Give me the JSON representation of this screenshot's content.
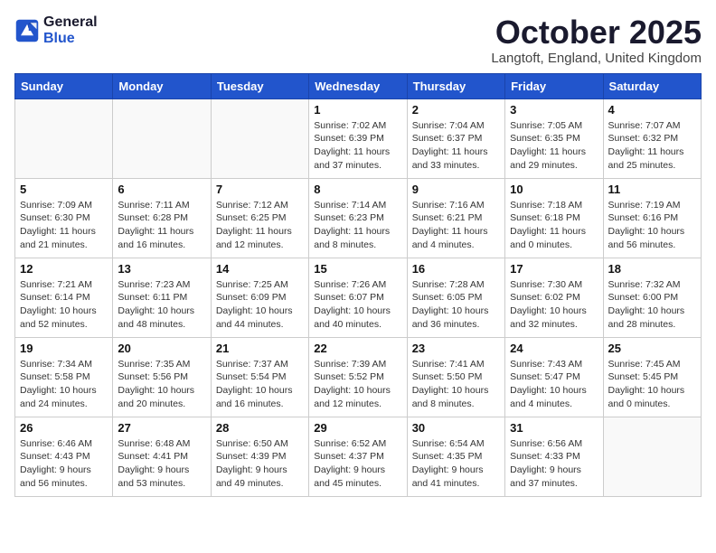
{
  "logo": {
    "line1": "General",
    "line2": "Blue"
  },
  "title": "October 2025",
  "location": "Langtoft, England, United Kingdom",
  "days_of_week": [
    "Sunday",
    "Monday",
    "Tuesday",
    "Wednesday",
    "Thursday",
    "Friday",
    "Saturday"
  ],
  "weeks": [
    [
      {
        "day": "",
        "info": ""
      },
      {
        "day": "",
        "info": ""
      },
      {
        "day": "",
        "info": ""
      },
      {
        "day": "1",
        "info": "Sunrise: 7:02 AM\nSunset: 6:39 PM\nDaylight: 11 hours\nand 37 minutes."
      },
      {
        "day": "2",
        "info": "Sunrise: 7:04 AM\nSunset: 6:37 PM\nDaylight: 11 hours\nand 33 minutes."
      },
      {
        "day": "3",
        "info": "Sunrise: 7:05 AM\nSunset: 6:35 PM\nDaylight: 11 hours\nand 29 minutes."
      },
      {
        "day": "4",
        "info": "Sunrise: 7:07 AM\nSunset: 6:32 PM\nDaylight: 11 hours\nand 25 minutes."
      }
    ],
    [
      {
        "day": "5",
        "info": "Sunrise: 7:09 AM\nSunset: 6:30 PM\nDaylight: 11 hours\nand 21 minutes."
      },
      {
        "day": "6",
        "info": "Sunrise: 7:11 AM\nSunset: 6:28 PM\nDaylight: 11 hours\nand 16 minutes."
      },
      {
        "day": "7",
        "info": "Sunrise: 7:12 AM\nSunset: 6:25 PM\nDaylight: 11 hours\nand 12 minutes."
      },
      {
        "day": "8",
        "info": "Sunrise: 7:14 AM\nSunset: 6:23 PM\nDaylight: 11 hours\nand 8 minutes."
      },
      {
        "day": "9",
        "info": "Sunrise: 7:16 AM\nSunset: 6:21 PM\nDaylight: 11 hours\nand 4 minutes."
      },
      {
        "day": "10",
        "info": "Sunrise: 7:18 AM\nSunset: 6:18 PM\nDaylight: 11 hours\nand 0 minutes."
      },
      {
        "day": "11",
        "info": "Sunrise: 7:19 AM\nSunset: 6:16 PM\nDaylight: 10 hours\nand 56 minutes."
      }
    ],
    [
      {
        "day": "12",
        "info": "Sunrise: 7:21 AM\nSunset: 6:14 PM\nDaylight: 10 hours\nand 52 minutes."
      },
      {
        "day": "13",
        "info": "Sunrise: 7:23 AM\nSunset: 6:11 PM\nDaylight: 10 hours\nand 48 minutes."
      },
      {
        "day": "14",
        "info": "Sunrise: 7:25 AM\nSunset: 6:09 PM\nDaylight: 10 hours\nand 44 minutes."
      },
      {
        "day": "15",
        "info": "Sunrise: 7:26 AM\nSunset: 6:07 PM\nDaylight: 10 hours\nand 40 minutes."
      },
      {
        "day": "16",
        "info": "Sunrise: 7:28 AM\nSunset: 6:05 PM\nDaylight: 10 hours\nand 36 minutes."
      },
      {
        "day": "17",
        "info": "Sunrise: 7:30 AM\nSunset: 6:02 PM\nDaylight: 10 hours\nand 32 minutes."
      },
      {
        "day": "18",
        "info": "Sunrise: 7:32 AM\nSunset: 6:00 PM\nDaylight: 10 hours\nand 28 minutes."
      }
    ],
    [
      {
        "day": "19",
        "info": "Sunrise: 7:34 AM\nSunset: 5:58 PM\nDaylight: 10 hours\nand 24 minutes."
      },
      {
        "day": "20",
        "info": "Sunrise: 7:35 AM\nSunset: 5:56 PM\nDaylight: 10 hours\nand 20 minutes."
      },
      {
        "day": "21",
        "info": "Sunrise: 7:37 AM\nSunset: 5:54 PM\nDaylight: 10 hours\nand 16 minutes."
      },
      {
        "day": "22",
        "info": "Sunrise: 7:39 AM\nSunset: 5:52 PM\nDaylight: 10 hours\nand 12 minutes."
      },
      {
        "day": "23",
        "info": "Sunrise: 7:41 AM\nSunset: 5:50 PM\nDaylight: 10 hours\nand 8 minutes."
      },
      {
        "day": "24",
        "info": "Sunrise: 7:43 AM\nSunset: 5:47 PM\nDaylight: 10 hours\nand 4 minutes."
      },
      {
        "day": "25",
        "info": "Sunrise: 7:45 AM\nSunset: 5:45 PM\nDaylight: 10 hours\nand 0 minutes."
      }
    ],
    [
      {
        "day": "26",
        "info": "Sunrise: 6:46 AM\nSunset: 4:43 PM\nDaylight: 9 hours\nand 56 minutes."
      },
      {
        "day": "27",
        "info": "Sunrise: 6:48 AM\nSunset: 4:41 PM\nDaylight: 9 hours\nand 53 minutes."
      },
      {
        "day": "28",
        "info": "Sunrise: 6:50 AM\nSunset: 4:39 PM\nDaylight: 9 hours\nand 49 minutes."
      },
      {
        "day": "29",
        "info": "Sunrise: 6:52 AM\nSunset: 4:37 PM\nDaylight: 9 hours\nand 45 minutes."
      },
      {
        "day": "30",
        "info": "Sunrise: 6:54 AM\nSunset: 4:35 PM\nDaylight: 9 hours\nand 41 minutes."
      },
      {
        "day": "31",
        "info": "Sunrise: 6:56 AM\nSunset: 4:33 PM\nDaylight: 9 hours\nand 37 minutes."
      },
      {
        "day": "",
        "info": ""
      }
    ]
  ]
}
